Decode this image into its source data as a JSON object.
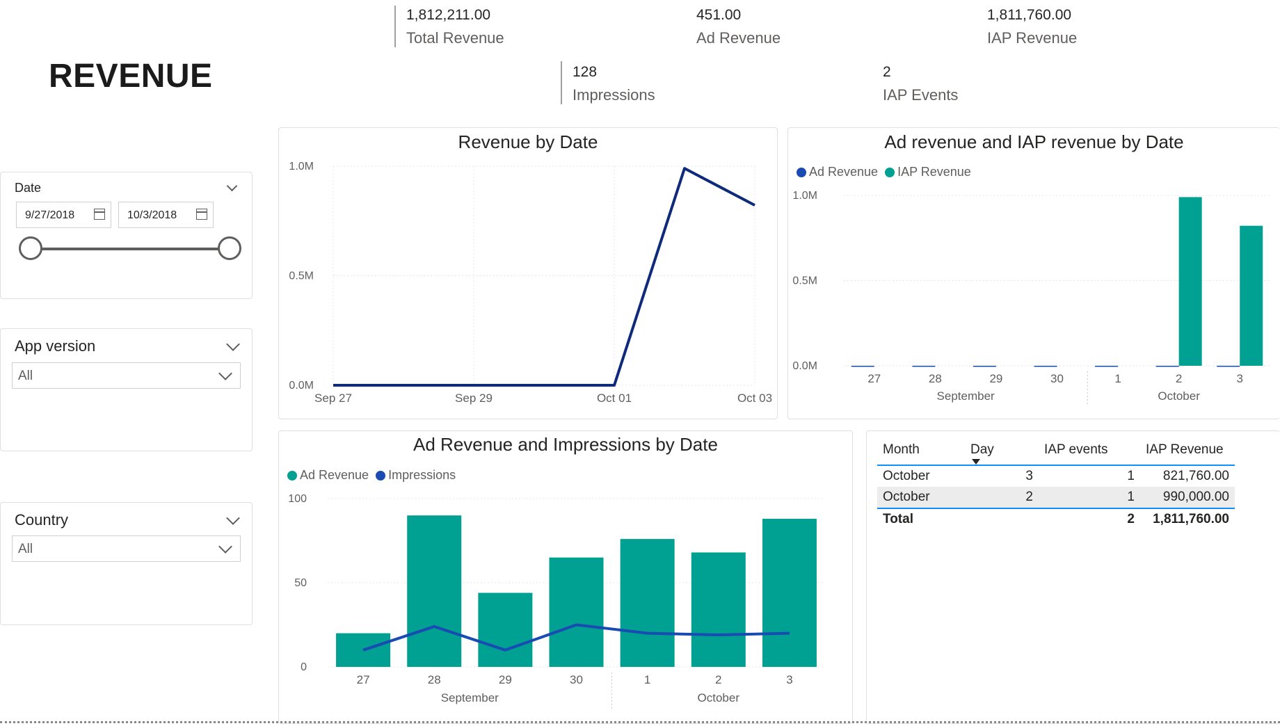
{
  "page_title": "REVENUE",
  "kpis": [
    {
      "value": "1,812,211.00",
      "label": "Total Revenue"
    },
    {
      "value": "451.00",
      "label": "Ad Revenue"
    },
    {
      "value": "1,811,760.00",
      "label": "IAP Revenue"
    },
    {
      "value": "128",
      "label": "Impressions"
    },
    {
      "value": "2",
      "label": "IAP Events"
    }
  ],
  "slicers": {
    "date": {
      "title": "Date",
      "start": "9/27/2018",
      "end": "10/3/2018"
    },
    "app_version": {
      "title": "App version",
      "selected": "All"
    },
    "country": {
      "title": "Country",
      "selected": "All"
    }
  },
  "colors": {
    "navy": "#0e2a7a",
    "teal": "#00a092",
    "blue": "#1a4bb3"
  },
  "charts": {
    "revenue_by_date": {
      "title": "Revenue by Date"
    },
    "ad_iap_by_date": {
      "title": "Ad revenue and IAP revenue by Date",
      "legend": [
        "Ad Revenue",
        "IAP Revenue"
      ]
    },
    "ad_impr_by_date": {
      "title": "Ad Revenue and Impressions by Date",
      "legend": [
        "Ad Revenue",
        "Impressions"
      ]
    }
  },
  "chart_data": [
    {
      "type": "line",
      "title": "Revenue by Date",
      "x": [
        "Sep 27",
        "Sep 28",
        "Sep 29",
        "Sep 30",
        "Oct 01",
        "Oct 02",
        "Oct 03"
      ],
      "x_tick_labels": [
        "Sep 27",
        "Sep 29",
        "Oct 01",
        "Oct 03"
      ],
      "series": [
        {
          "values": [
            0,
            0,
            0,
            0,
            0,
            990000,
            821760
          ]
        }
      ],
      "y_ticks": [
        "0.0M",
        "0.5M",
        "1.0M"
      ],
      "ylim": [
        0,
        1000000
      ],
      "grid": true
    },
    {
      "type": "bar",
      "title": "Ad revenue and IAP revenue by Date",
      "categories": [
        "27",
        "28",
        "29",
        "30",
        "1",
        "2",
        "3"
      ],
      "groups": [
        "September",
        "October"
      ],
      "series": [
        {
          "name": "Ad Revenue",
          "values": [
            20,
            90,
            44,
            65,
            76,
            68,
            88
          ]
        },
        {
          "name": "IAP Revenue",
          "values": [
            0,
            0,
            0,
            0,
            0,
            990000,
            821760
          ]
        }
      ],
      "y_ticks": [
        "0.0M",
        "0.5M",
        "1.0M"
      ],
      "ylim": [
        0,
        1000000
      ],
      "legend": "top-left",
      "grid": true
    },
    {
      "type": "bar",
      "title": "Ad Revenue and Impressions by Date",
      "categories": [
        "27",
        "28",
        "29",
        "30",
        "1",
        "2",
        "3"
      ],
      "groups": [
        "September",
        "October"
      ],
      "series": [
        {
          "name": "Ad Revenue",
          "values": [
            20,
            90,
            44,
            65,
            76,
            68,
            88
          ]
        },
        {
          "name": "Impressions",
          "values": [
            10,
            24,
            10,
            25,
            20,
            19,
            20
          ]
        }
      ],
      "y_ticks": [
        "0",
        "50",
        "100"
      ],
      "ylim": [
        0,
        100
      ],
      "legend": "top-left",
      "grid": true
    }
  ],
  "table": {
    "headers": [
      "Month",
      "Day",
      "IAP events",
      "IAP Revenue"
    ],
    "rows": [
      [
        "October",
        "3",
        "1",
        "821,760.00"
      ],
      [
        "October",
        "2",
        "1",
        "990,000.00"
      ]
    ],
    "total": [
      "Total",
      "",
      "2",
      "1,811,760.00"
    ]
  }
}
